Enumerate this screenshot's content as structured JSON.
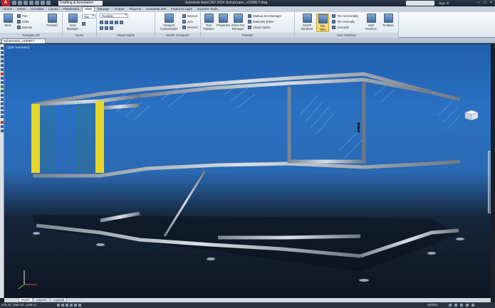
{
  "app": {
    "menu_letter": "A",
    "workspace": "Drafting & Annotation",
    "window_title": "Autodesk AutoCAD 2014   Schutzzaun_v100817.dwg",
    "search_placeholder": "",
    "sign_in": "Sign In"
  },
  "ribbon_tabs": [
    "Home",
    "Insert",
    "Annotate",
    "Layout",
    "Parametric",
    "View",
    "Manage",
    "Output",
    "Plug-ins",
    "Autodesk 360",
    "Featured Apps",
    "Express Tools"
  ],
  "active_tab": "View",
  "ribbon": {
    "navigate": {
      "title": "Navigate 2D",
      "back": "Back",
      "pan": "Pan",
      "orbit": "Orbit",
      "extents": "Extents",
      "forward": "Forward"
    },
    "views": {
      "title": "Views",
      "view_manager": "View Manager",
      "current_view": "Top",
      "home": "Home"
    },
    "visual_styles": {
      "title": "Visual Styles",
      "current_style": "Realistic",
      "row2": "Realistic",
      "row3": ""
    },
    "model_viewports": {
      "title": "Model Viewports",
      "viewport_configuration": "Viewport Configuration",
      "named": "Named",
      "join": "Join",
      "restore": "Restore"
    },
    "palettes": {
      "title": "Palettes",
      "tool_palettes": "Tool Palettes",
      "properties": "Properties",
      "sheet_set_manager": "Sheet Set Manager",
      "markup_set_manager": "Markup Set Manager",
      "materials_editor": "Materials Editor",
      "visual_styles_small": "Visual Styles"
    },
    "windows": {
      "title": "User Interface",
      "switch_windows": "Switch Windows",
      "file_tabs": "File Tabs",
      "tile_horizontally": "Tile Horizontally",
      "tile_vertically": "Tile Vertically",
      "cascade": "Cascade",
      "user_interface": "User Interface",
      "toolbars": "Toolbars"
    }
  },
  "file_tab": "Schutzzaun_v100817",
  "viewport_label": "[-][SE Isometric]",
  "layout_tabs": [
    "Model",
    "Layout1",
    "Layout2"
  ],
  "active_layout": "Model",
  "status": {
    "coords": "575.18, 1561.61, 1188.11",
    "model_label": "MODEL"
  },
  "colors": {
    "viewport_sky": "#2b6ab4",
    "frame": "#b9c2cc",
    "mesh_yellow": "#e6d82a",
    "glass_lines": "#7fe0ff"
  }
}
